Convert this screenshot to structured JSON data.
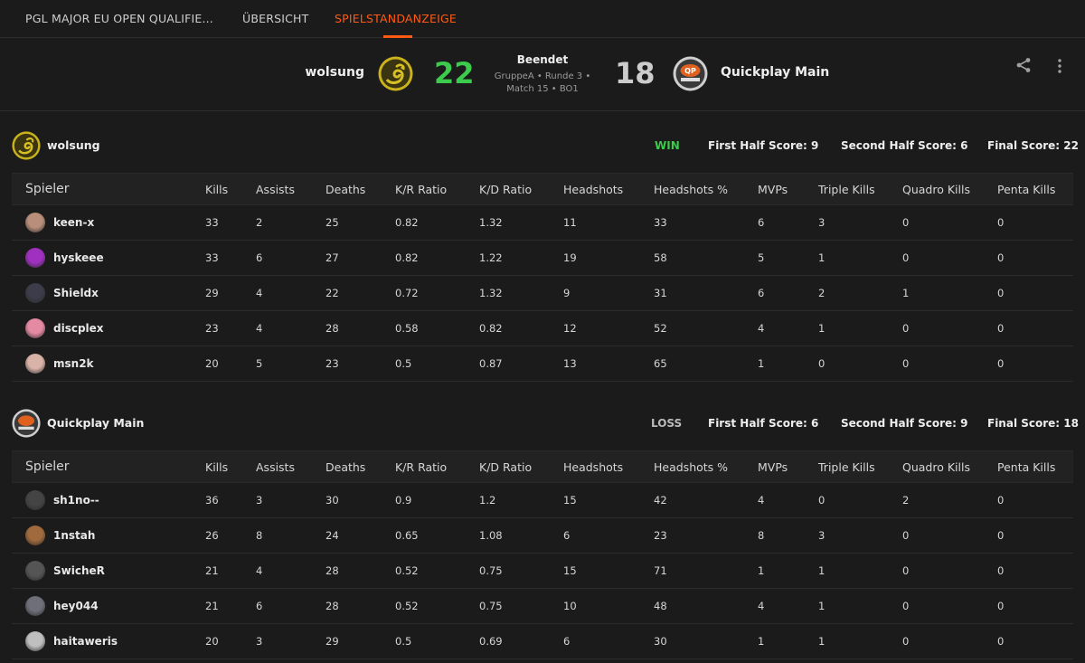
{
  "nav": {
    "tabs": [
      "PGL MAJOR EU OPEN QUALIFIE...",
      "ÜBERSICHT",
      "SPIELSTANDANZEIGE"
    ],
    "active_tab": "SPIELSTANDANZEIGE",
    "accent_color": "#ff5a14"
  },
  "match": {
    "team1": {
      "name": "wolsung",
      "score": "22",
      "score_color": "#3ccb4c",
      "logo_icon": "serpent-logo"
    },
    "team2": {
      "name": "Quickplay Main",
      "score": "18",
      "score_color": "#cccccc",
      "logo_icon": "qp-logo"
    },
    "status": "Beendet",
    "info_line1": "GruppeA • Runde 3 •",
    "info_line2": "Match 15 • BO1",
    "actions": [
      "share-icon",
      "more-vertical-icon"
    ]
  },
  "columns": [
    "Spieler",
    "Kills",
    "Assists",
    "Deaths",
    "K/R Ratio",
    "K/D Ratio",
    "Headshots",
    "Headshots %",
    "MVPs",
    "Triple Kills",
    "Quadro Kills",
    "Penta Kills"
  ],
  "teams": [
    {
      "name": "wolsung",
      "result": "WIN",
      "result_color": "#3ccb4c",
      "first_half": "First Half Score: 9",
      "second_half": "Second Half Score: 6",
      "final": "Final Score: 22",
      "players": [
        {
          "name": "keen-x",
          "avatar_color": "#b98f7a",
          "stats": [
            "33",
            "2",
            "25",
            "0.82",
            "1.32",
            "11",
            "33",
            "6",
            "3",
            "0",
            "0"
          ]
        },
        {
          "name": "hyskeee",
          "avatar_color": "#a030c0",
          "stats": [
            "33",
            "6",
            "27",
            "0.82",
            "1.22",
            "19",
            "58",
            "5",
            "1",
            "0",
            "0"
          ]
        },
        {
          "name": "Shieldx",
          "avatar_color": "#3c3c4a",
          "stats": [
            "29",
            "4",
            "22",
            "0.72",
            "1.32",
            "9",
            "31",
            "6",
            "2",
            "1",
            "0"
          ]
        },
        {
          "name": "discplex",
          "avatar_color": "#e58aa3",
          "stats": [
            "23",
            "4",
            "28",
            "0.58",
            "0.82",
            "12",
            "52",
            "4",
            "1",
            "0",
            "0"
          ]
        },
        {
          "name": "msn2k",
          "avatar_color": "#d9b3a8",
          "stats": [
            "20",
            "5",
            "23",
            "0.5",
            "0.87",
            "13",
            "65",
            "1",
            "0",
            "0",
            "0"
          ]
        }
      ]
    },
    {
      "name": "Quickplay Main",
      "result": "LOSS",
      "result_color": "#bbbbbb",
      "first_half": "First Half Score: 6",
      "second_half": "Second Half Score: 9",
      "final": "Final Score: 18",
      "players": [
        {
          "name": "sh1no--",
          "avatar_color": "#444444",
          "stats": [
            "36",
            "3",
            "30",
            "0.9",
            "1.2",
            "15",
            "42",
            "4",
            "0",
            "2",
            "0"
          ]
        },
        {
          "name": "1nstah",
          "avatar_color": "#a06a3c",
          "stats": [
            "26",
            "8",
            "24",
            "0.65",
            "1.08",
            "6",
            "23",
            "8",
            "3",
            "0",
            "0"
          ]
        },
        {
          "name": "SwicheR",
          "avatar_color": "#555555",
          "stats": [
            "21",
            "4",
            "28",
            "0.52",
            "0.75",
            "15",
            "71",
            "1",
            "1",
            "0",
            "0"
          ]
        },
        {
          "name": "hey044",
          "avatar_color": "#6f6f7a",
          "stats": [
            "21",
            "6",
            "28",
            "0.52",
            "0.75",
            "10",
            "48",
            "4",
            "1",
            "0",
            "0"
          ]
        },
        {
          "name": "haitaweris",
          "avatar_color": "#bfbfbf",
          "stats": [
            "20",
            "3",
            "29",
            "0.5",
            "0.69",
            "6",
            "30",
            "1",
            "1",
            "0",
            "0"
          ]
        }
      ]
    }
  ]
}
